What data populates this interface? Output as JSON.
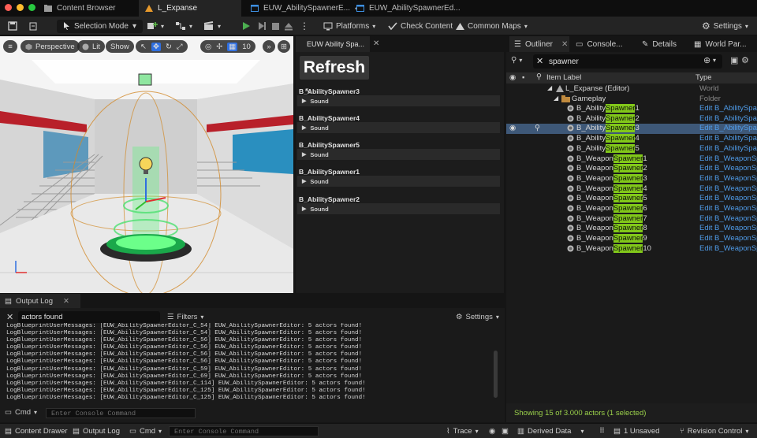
{
  "titlebar": {
    "tabs": [
      {
        "label": "Content Browser"
      },
      {
        "label": "L_Expanse"
      },
      {
        "label": "EUW_AbilitySpawnerE..."
      },
      {
        "label": "EUW_AbilitySpawnerEd..."
      }
    ],
    "dot_colors": [
      "#ff5f57",
      "#febc2e",
      "#28c840"
    ]
  },
  "toolbar": {
    "selection_mode": "Selection Mode",
    "platforms": "Platforms",
    "check_content": "Check Content",
    "common_maps": "Common Maps",
    "settings": "Settings",
    "play_color": "#4caf50"
  },
  "viewport": {
    "perspective": "Perspective",
    "lit": "Lit",
    "show": "Show",
    "grid_value": "10"
  },
  "euw": {
    "tab_label": "EUW Ability Spa...",
    "refresh_label": "Refresh",
    "sound_label": "Sound",
    "spawners": [
      {
        "title": "B_AbilitySpawner3"
      },
      {
        "title": "B_AbilitySpawner4"
      },
      {
        "title": "B_AbilitySpawner5"
      },
      {
        "title": "B_AbilitySpawner1"
      },
      {
        "title": "B_AbilitySpawner2"
      }
    ]
  },
  "outliner": {
    "tabs": [
      {
        "label": "Outliner"
      },
      {
        "label": "Console..."
      },
      {
        "label": "Details"
      },
      {
        "label": "World Par..."
      }
    ],
    "search_value": "spawner",
    "col_label": "Item Label",
    "col_type": "Type",
    "world_row": {
      "name": "L_Expanse (Editor)",
      "type": "World"
    },
    "folder_row": {
      "name": "Gameplay",
      "type": "Folder"
    },
    "items": [
      {
        "pre": "B_Ability",
        "hit": "Spawner",
        "post": "1",
        "type": "Edit B_AbilitySpaw"
      },
      {
        "pre": "B_Ability",
        "hit": "Spawner",
        "post": "2",
        "type": "Edit B_AbilitySpaw"
      },
      {
        "pre": "B_Ability",
        "hit": "Spawner",
        "post": "3",
        "type": "Edit B_AbilitySpaw",
        "selected": true
      },
      {
        "pre": "B_Ability",
        "hit": "Spawner",
        "post": "4",
        "type": "Edit B_AbilitySpaw"
      },
      {
        "pre": "B_Ability",
        "hit": "Spawner",
        "post": "5",
        "type": "Edit B_AbilitySpaw"
      },
      {
        "pre": "B_Weapon",
        "hit": "Spawner",
        "post": "1",
        "type": "Edit B_WeaponSpa"
      },
      {
        "pre": "B_Weapon",
        "hit": "Spawner",
        "post": "2",
        "type": "Edit B_WeaponSpa"
      },
      {
        "pre": "B_Weapon",
        "hit": "Spawner",
        "post": "3",
        "type": "Edit B_WeaponSpa"
      },
      {
        "pre": "B_Weapon",
        "hit": "Spawner",
        "post": "4",
        "type": "Edit B_WeaponSpa"
      },
      {
        "pre": "B_Weapon",
        "hit": "Spawner",
        "post": "5",
        "type": "Edit B_WeaponSpa"
      },
      {
        "pre": "B_Weapon",
        "hit": "Spawner",
        "post": "6",
        "type": "Edit B_WeaponSpa"
      },
      {
        "pre": "B_Weapon",
        "hit": "Spawner",
        "post": "7",
        "type": "Edit B_WeaponSpa"
      },
      {
        "pre": "B_Weapon",
        "hit": "Spawner",
        "post": "8",
        "type": "Edit B_WeaponSpa"
      },
      {
        "pre": "B_Weapon",
        "hit": "Spawner",
        "post": "9",
        "type": "Edit B_WeaponSpa"
      },
      {
        "pre": "B_Weapon",
        "hit": "Spawner",
        "post": "10",
        "type": "Edit B_WeaponSpa"
      }
    ],
    "status": "Showing 15 of 3.000 actors (1 selected)"
  },
  "outlog": {
    "tab_label": "Output Log",
    "search_value": "actors found",
    "filters_label": "Filters",
    "settings_label": "Settings",
    "cmd_label": "Cmd",
    "console_placeholder": "Enter Console Command",
    "lines": [
      "LogBlueprintUserMessages: [EUW_AbilitySpawnerEditor_C_54] EUW_AbilitySpawnerEditor: 5 actors found!",
      "LogBlueprintUserMessages: [EUW_AbilitySpawnerEditor_C_54] EUW_AbilitySpawnerEditor: 5 actors found!",
      "LogBlueprintUserMessages: [EUW_AbilitySpawnerEditor_C_56] EUW_AbilitySpawnerEditor: 5 actors found!",
      "LogBlueprintUserMessages: [EUW_AbilitySpawnerEditor_C_56] EUW_AbilitySpawnerEditor: 5 actors found!",
      "LogBlueprintUserMessages: [EUW_AbilitySpawnerEditor_C_56] EUW_AbilitySpawnerEditor: 5 actors found!",
      "LogBlueprintUserMessages: [EUW_AbilitySpawnerEditor_C_56] EUW_AbilitySpawnerEditor: 5 actors found!",
      "LogBlueprintUserMessages: [EUW_AbilitySpawnerEditor_C_59] EUW_AbilitySpawnerEditor: 5 actors found!",
      "LogBlueprintUserMessages: [EUW_AbilitySpawnerEditor_C_69] EUW_AbilitySpawnerEditor: 5 actors found!",
      "LogBlueprintUserMessages: [EUW_AbilitySpawnerEditor_C_114] EUW_AbilitySpawnerEditor: 5 actors found!",
      "LogBlueprintUserMessages: [EUW_AbilitySpawnerEditor_C_125] EUW_AbilitySpawnerEditor: 5 actors found!",
      "LogBlueprintUserMessages: [EUW_AbilitySpawnerEditor_C_125] EUW_AbilitySpawnerEditor: 5 actors found!"
    ]
  },
  "bottombar": {
    "content_drawer": "Content Drawer",
    "output_log": "Output Log",
    "cmd": "Cmd",
    "console_placeholder": "Enter Console Command",
    "trace": "Trace",
    "derived_data": "Derived Data",
    "unsaved": "1 Unsaved",
    "revision_control": "Revision Control"
  }
}
